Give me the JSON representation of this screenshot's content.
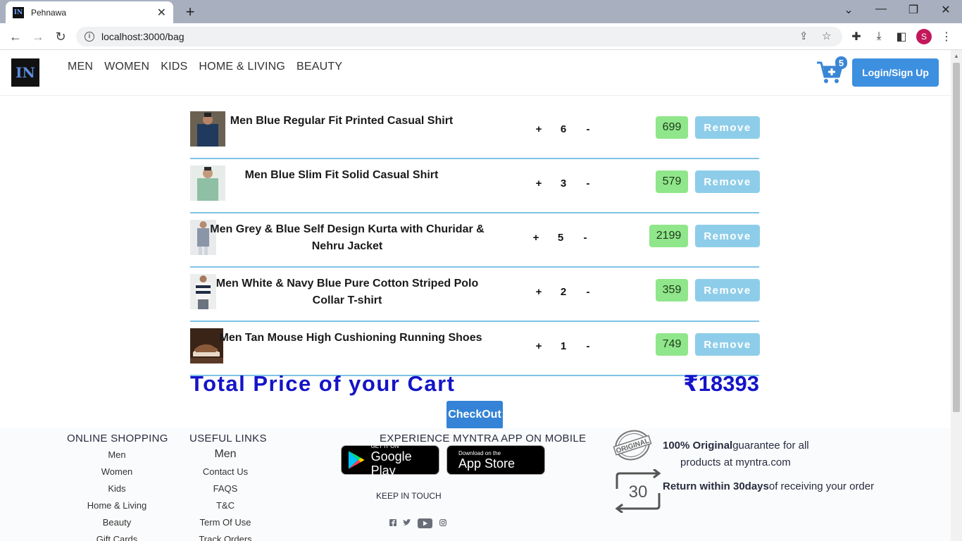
{
  "browser": {
    "tab_title": "Pehnawa",
    "tab_favicon": "IN",
    "url": "localhost:3000/bag",
    "profile_initial": "S"
  },
  "site": {
    "logo_text": "IN",
    "nav": [
      "MEN",
      "WOMEN",
      "KIDS",
      "HOME & LIVING",
      "BEAUTY"
    ],
    "cart_count": "5",
    "login_label": "Login/Sign Up"
  },
  "cart": {
    "items": [
      {
        "name": "Men Blue Regular Fit Printed Casual Shirt",
        "plus": "+",
        "qty": "6",
        "minus": "-",
        "price": "699",
        "remove": "Remove"
      },
      {
        "name": "Men Blue Slim Fit Solid Casual Shirt",
        "plus": "+",
        "qty": "3",
        "minus": "-",
        "price": "579",
        "remove": "Remove"
      },
      {
        "name": "Men Grey & Blue Self Design Kurta with Churidar & Nehru Jacket",
        "plus": "+",
        "qty": "5",
        "minus": "-",
        "price": "2199",
        "remove": "Remove"
      },
      {
        "name": "Men White & Navy Blue Pure Cotton Striped Polo Collar T-shirt",
        "plus": "+",
        "qty": "2",
        "minus": "-",
        "price": "359",
        "remove": "Remove"
      },
      {
        "name": "Men Tan Mouse High Cushioning Running Shoes",
        "plus": "+",
        "qty": "1",
        "minus": "-",
        "price": "749",
        "remove": "Remove"
      }
    ],
    "total_label": "Total Price of your Cart",
    "total_value": "₹18393",
    "checkout_label": "CheckOut"
  },
  "footer": {
    "online_shopping": {
      "title": "ONLINE SHOPPING",
      "links": [
        "Men",
        "Women",
        "Kids",
        "Home & Living",
        "Beauty",
        "Gift Cards"
      ]
    },
    "useful_links": {
      "title": "USEFUL LINKS",
      "links": [
        "Men",
        "Contact Us",
        "FAQS",
        "T&C",
        "Term Of Use",
        "Track Orders"
      ]
    },
    "app": {
      "title": "EXPERIENCE MYNTRA APP ON MOBILE",
      "google_small": "GET IT ON",
      "google_big": "Google Play",
      "apple_small": "Download on the",
      "apple_big": "App Store",
      "keep_in_touch": "KEEP IN TOUCH",
      "social_icons": [
        "facebook-icon",
        "twitter-icon",
        "youtube-icon",
        "instagram-icon"
      ]
    },
    "features": {
      "stamp_text": "ORIGINAL",
      "original_bold": "100% Original",
      "original_rest": "guarantee for all",
      "original_line2": "products at myntra.com",
      "return_number": "30",
      "return_bold": "Return within 30days",
      "return_rest": "of receiving your order"
    }
  },
  "colors": {
    "accent_blue": "#3d8fe0",
    "total_blue": "#1414c8",
    "price_green": "#90e68a",
    "remove_blue": "#8ecde9",
    "divider": "#7ec3e6"
  }
}
